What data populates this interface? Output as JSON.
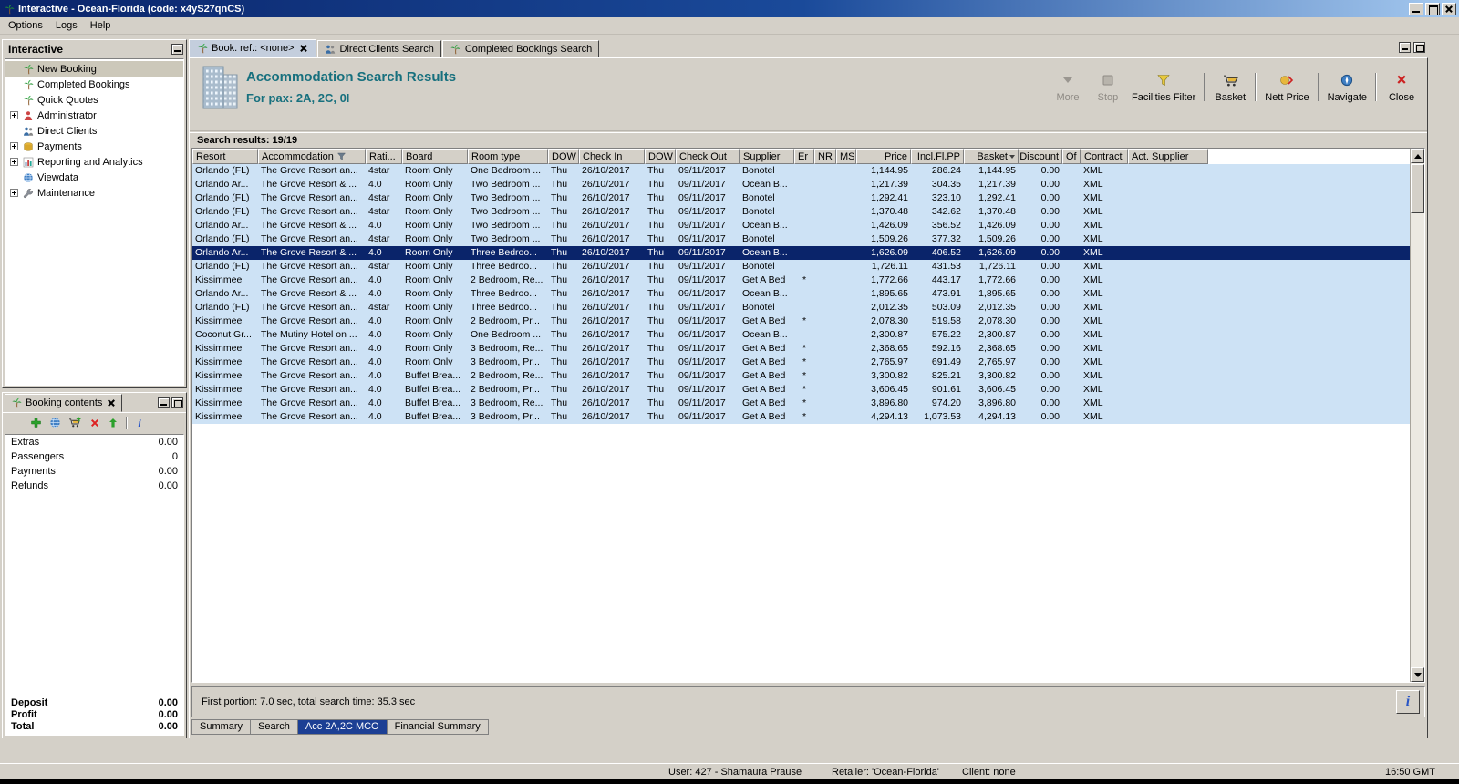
{
  "window": {
    "title": "Interactive - Ocean-Florida (code: x4yS27qnCS)"
  },
  "menu_bar": {
    "items": [
      "Options",
      "Logs",
      "Help"
    ]
  },
  "sidebar": {
    "title": "Interactive",
    "items": [
      {
        "label": "New Booking",
        "icon": "palm-icon",
        "expandable": false,
        "selected": true
      },
      {
        "label": "Completed Bookings",
        "icon": "palm-icon",
        "expandable": false,
        "selected": false
      },
      {
        "label": "Quick Quotes",
        "icon": "palm-icon",
        "expandable": false,
        "selected": false
      },
      {
        "label": "Administrator",
        "icon": "admin-icon",
        "expandable": true,
        "selected": false
      },
      {
        "label": "Direct Clients",
        "icon": "clients-icon",
        "expandable": false,
        "selected": false
      },
      {
        "label": "Payments",
        "icon": "payments-icon",
        "expandable": true,
        "selected": false
      },
      {
        "label": "Reporting and Analytics",
        "icon": "reporting-icon",
        "expandable": true,
        "selected": false
      },
      {
        "label": "Viewdata",
        "icon": "viewdata-icon",
        "expandable": false,
        "selected": false
      },
      {
        "label": "Maintenance",
        "icon": "maintenance-icon",
        "expandable": true,
        "selected": false
      }
    ]
  },
  "booking_contents": {
    "title": "Booking contents",
    "toolbar": [
      "add-icon",
      "globe-icon",
      "basket-add-icon",
      "delete-icon",
      "export-icon",
      "info-icon"
    ],
    "items": [
      {
        "label": "Extras",
        "value": "0.00"
      },
      {
        "label": "Passengers",
        "value": "0"
      },
      {
        "label": "Payments",
        "value": "0.00"
      },
      {
        "label": "Refunds",
        "value": "0.00"
      }
    ],
    "totals": [
      {
        "label": "Deposit",
        "value": "0.00"
      },
      {
        "label": "Profit",
        "value": "0.00"
      },
      {
        "label": "Total",
        "value": "0.00"
      }
    ]
  },
  "tabs": [
    {
      "label": "Book. ref.: <none>",
      "icon": "palm-icon",
      "closable": true,
      "active": true
    },
    {
      "label": "Direct Clients Search",
      "icon": "clients-icon",
      "closable": false,
      "active": false
    },
    {
      "label": "Completed Bookings Search",
      "icon": "palm-icon",
      "closable": false,
      "active": false
    }
  ],
  "results": {
    "title": "Accommodation Search Results",
    "subtitle": "For pax: 2A, 2C, 0I",
    "toolbar": [
      {
        "label": "More",
        "icon": "more-icon",
        "enabled": false
      },
      {
        "label": "Stop",
        "icon": "stop-icon",
        "enabled": false
      },
      {
        "label": "Facilities Filter",
        "icon": "filter-icon",
        "enabled": true
      },
      {
        "label": "Basket",
        "icon": "basket-icon",
        "enabled": true
      },
      {
        "label": "Nett Price",
        "icon": "nett-price-icon",
        "enabled": true
      },
      {
        "label": "Navigate",
        "icon": "navigate-icon",
        "enabled": true
      },
      {
        "label": "Close",
        "icon": "close-icon",
        "enabled": true
      }
    ],
    "results_label": "Search results: 19/19",
    "status": "First portion: 7.0 sec, total search time: 35.3 sec"
  },
  "table": {
    "columns": [
      "Resort",
      "Accommodation",
      "Rati...",
      "Board",
      "Room type",
      "DOW",
      "Check In",
      "DOW",
      "Check Out",
      "Supplier",
      "Er",
      "NR",
      "MS",
      "Price",
      "Incl.Fl.PP",
      "Basket",
      "Discount",
      "Of",
      "Contract",
      "Act. Supplier"
    ],
    "selected_row_index": 6,
    "rows": [
      [
        "Orlando (FL)",
        "The Grove Resort an...",
        "4star",
        "Room Only",
        "One Bedroom ...",
        "Thu",
        "26/10/2017",
        "Thu",
        "09/11/2017",
        "Bonotel",
        "",
        "",
        "",
        "1,144.95",
        "286.24",
        "1,144.95",
        "0.00",
        "",
        "XML",
        ""
      ],
      [
        "Orlando Ar...",
        "The Grove Resort & ...",
        "4.0",
        "Room Only",
        "Two Bedroom ...",
        "Thu",
        "26/10/2017",
        "Thu",
        "09/11/2017",
        "Ocean B...",
        "",
        "",
        "",
        "1,217.39",
        "304.35",
        "1,217.39",
        "0.00",
        "",
        "XML",
        ""
      ],
      [
        "Orlando (FL)",
        "The Grove Resort an...",
        "4star",
        "Room Only",
        "Two Bedroom ...",
        "Thu",
        "26/10/2017",
        "Thu",
        "09/11/2017",
        "Bonotel",
        "",
        "",
        "",
        "1,292.41",
        "323.10",
        "1,292.41",
        "0.00",
        "",
        "XML",
        ""
      ],
      [
        "Orlando (FL)",
        "The Grove Resort an...",
        "4star",
        "Room Only",
        "Two Bedroom ...",
        "Thu",
        "26/10/2017",
        "Thu",
        "09/11/2017",
        "Bonotel",
        "",
        "",
        "",
        "1,370.48",
        "342.62",
        "1,370.48",
        "0.00",
        "",
        "XML",
        ""
      ],
      [
        "Orlando Ar...",
        "The Grove Resort & ...",
        "4.0",
        "Room Only",
        "Two Bedroom ...",
        "Thu",
        "26/10/2017",
        "Thu",
        "09/11/2017",
        "Ocean B...",
        "",
        "",
        "",
        "1,426.09",
        "356.52",
        "1,426.09",
        "0.00",
        "",
        "XML",
        ""
      ],
      [
        "Orlando (FL)",
        "The Grove Resort an...",
        "4star",
        "Room Only",
        "Two Bedroom ...",
        "Thu",
        "26/10/2017",
        "Thu",
        "09/11/2017",
        "Bonotel",
        "",
        "",
        "",
        "1,509.26",
        "377.32",
        "1,509.26",
        "0.00",
        "",
        "XML",
        ""
      ],
      [
        "Orlando Ar...",
        "The Grove Resort & ...",
        "4.0",
        "Room Only",
        "Three Bedroo...",
        "Thu",
        "26/10/2017",
        "Thu",
        "09/11/2017",
        "Ocean B...",
        "",
        "",
        "",
        "1,626.09",
        "406.52",
        "1,626.09",
        "0.00",
        "",
        "XML",
        ""
      ],
      [
        "Orlando (FL)",
        "The Grove Resort an...",
        "4star",
        "Room Only",
        "Three Bedroo...",
        "Thu",
        "26/10/2017",
        "Thu",
        "09/11/2017",
        "Bonotel",
        "",
        "",
        "",
        "1,726.11",
        "431.53",
        "1,726.11",
        "0.00",
        "",
        "XML",
        ""
      ],
      [
        "Kissimmee",
        "The Grove Resort an...",
        "4.0",
        "Room Only",
        "2 Bedroom, Re...",
        "Thu",
        "26/10/2017",
        "Thu",
        "09/11/2017",
        "Get A Bed",
        "*",
        "",
        "",
        "1,772.66",
        "443.17",
        "1,772.66",
        "0.00",
        "",
        "XML",
        ""
      ],
      [
        "Orlando Ar...",
        "The Grove Resort & ...",
        "4.0",
        "Room Only",
        "Three Bedroo...",
        "Thu",
        "26/10/2017",
        "Thu",
        "09/11/2017",
        "Ocean B...",
        "",
        "",
        "",
        "1,895.65",
        "473.91",
        "1,895.65",
        "0.00",
        "",
        "XML",
        ""
      ],
      [
        "Orlando (FL)",
        "The Grove Resort an...",
        "4star",
        "Room Only",
        "Three Bedroo...",
        "Thu",
        "26/10/2017",
        "Thu",
        "09/11/2017",
        "Bonotel",
        "",
        "",
        "",
        "2,012.35",
        "503.09",
        "2,012.35",
        "0.00",
        "",
        "XML",
        ""
      ],
      [
        "Kissimmee",
        "The Grove Resort an...",
        "4.0",
        "Room Only",
        "2 Bedroom, Pr...",
        "Thu",
        "26/10/2017",
        "Thu",
        "09/11/2017",
        "Get A Bed",
        "*",
        "",
        "",
        "2,078.30",
        "519.58",
        "2,078.30",
        "0.00",
        "",
        "XML",
        ""
      ],
      [
        "Coconut Gr...",
        "The Mutiny Hotel on ...",
        "4.0",
        "Room Only",
        "One Bedroom ...",
        "Thu",
        "26/10/2017",
        "Thu",
        "09/11/2017",
        "Ocean B...",
        "",
        "",
        "",
        "2,300.87",
        "575.22",
        "2,300.87",
        "0.00",
        "",
        "XML",
        ""
      ],
      [
        "Kissimmee",
        "The Grove Resort an...",
        "4.0",
        "Room Only",
        "3 Bedroom, Re...",
        "Thu",
        "26/10/2017",
        "Thu",
        "09/11/2017",
        "Get A Bed",
        "*",
        "",
        "",
        "2,368.65",
        "592.16",
        "2,368.65",
        "0.00",
        "",
        "XML",
        ""
      ],
      [
        "Kissimmee",
        "The Grove Resort an...",
        "4.0",
        "Room Only",
        "3 Bedroom, Pr...",
        "Thu",
        "26/10/2017",
        "Thu",
        "09/11/2017",
        "Get A Bed",
        "*",
        "",
        "",
        "2,765.97",
        "691.49",
        "2,765.97",
        "0.00",
        "",
        "XML",
        ""
      ],
      [
        "Kissimmee",
        "The Grove Resort an...",
        "4.0",
        "Buffet Brea...",
        "2 Bedroom, Re...",
        "Thu",
        "26/10/2017",
        "Thu",
        "09/11/2017",
        "Get A Bed",
        "*",
        "",
        "",
        "3,300.82",
        "825.21",
        "3,300.82",
        "0.00",
        "",
        "XML",
        ""
      ],
      [
        "Kissimmee",
        "The Grove Resort an...",
        "4.0",
        "Buffet Brea...",
        "2 Bedroom, Pr...",
        "Thu",
        "26/10/2017",
        "Thu",
        "09/11/2017",
        "Get A Bed",
        "*",
        "",
        "",
        "3,606.45",
        "901.61",
        "3,606.45",
        "0.00",
        "",
        "XML",
        ""
      ],
      [
        "Kissimmee",
        "The Grove Resort an...",
        "4.0",
        "Buffet Brea...",
        "3 Bedroom, Re...",
        "Thu",
        "26/10/2017",
        "Thu",
        "09/11/2017",
        "Get A Bed",
        "*",
        "",
        "",
        "3,896.80",
        "974.20",
        "3,896.80",
        "0.00",
        "",
        "XML",
        ""
      ],
      [
        "Kissimmee",
        "The Grove Resort an...",
        "4.0",
        "Buffet Brea...",
        "3 Bedroom, Pr...",
        "Thu",
        "26/10/2017",
        "Thu",
        "09/11/2017",
        "Get A Bed",
        "*",
        "",
        "",
        "4,294.13",
        "1,073.53",
        "4,294.13",
        "0.00",
        "",
        "XML",
        ""
      ]
    ]
  },
  "bottom_tabs": [
    {
      "label": "Summary",
      "active": false
    },
    {
      "label": "Search",
      "active": false
    },
    {
      "label": "Acc 2A,2C MCO",
      "active": true
    },
    {
      "label": "Financial Summary",
      "active": false
    }
  ],
  "status_bar": {
    "user": "User: 427 - Shamaura Prause",
    "retailer": "Retailer: 'Ocean-Florida'",
    "client": "Client: none",
    "time": "16:50 GMT"
  },
  "colors": {
    "titlebar_navy": "#0a246a",
    "accent_teal": "#17707e",
    "row_blue": "#cde2f5",
    "selection_navy": "#0a246a",
    "active_bottom_tab_blue": "#1c3f94",
    "window_gray": "#d4d0c8"
  }
}
